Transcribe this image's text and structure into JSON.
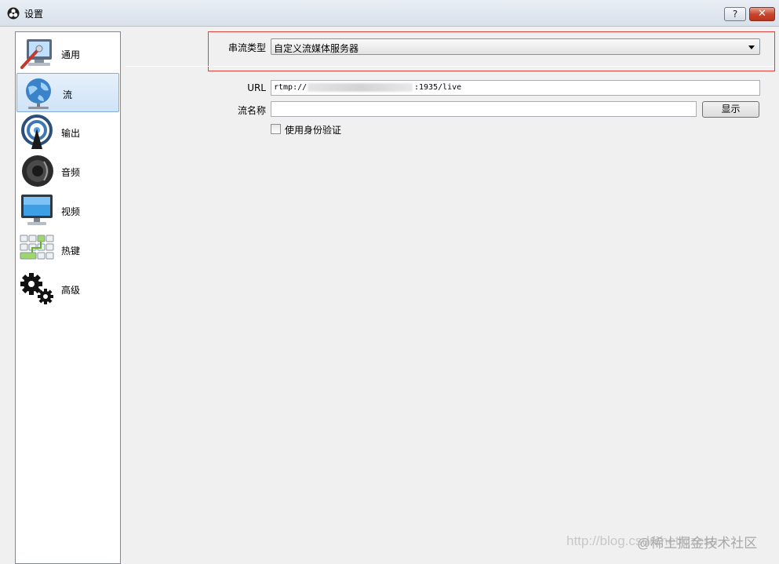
{
  "window": {
    "title": "设置",
    "help_label": "?",
    "close_label": "✕"
  },
  "sidebar": {
    "items": [
      {
        "label": "通用",
        "icon": "general-icon"
      },
      {
        "label": "流",
        "icon": "stream-globe-icon",
        "selected": true
      },
      {
        "label": "输出",
        "icon": "output-broadcast-icon"
      },
      {
        "label": "音频",
        "icon": "speaker-icon"
      },
      {
        "label": "视频",
        "icon": "monitor-icon"
      },
      {
        "label": "热键",
        "icon": "keyboard-icon"
      },
      {
        "label": "高级",
        "icon": "gears-icon"
      }
    ]
  },
  "stream": {
    "type_label": "串流类型",
    "type_value": "自定义流媒体服务器",
    "url_label": "URL",
    "url_prefix": "rtmp://",
    "url_suffix": ":1935/live",
    "key_label": "流名称",
    "key_value": "",
    "show_button": "显示",
    "auth_label": "使用身份验证",
    "auth_checked": false
  },
  "watermark": {
    "url_text": "http://blog.csdn.net/qzcsu",
    "brand_text": "@稀土掘金技术社区"
  },
  "colors": {
    "highlight_box": "#e04040",
    "selected_item": "#cfe3f8"
  }
}
